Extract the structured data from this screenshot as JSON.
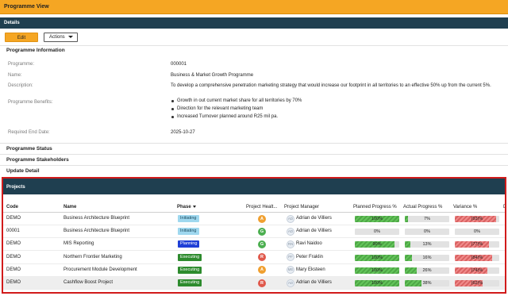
{
  "window": {
    "title": "Programme View"
  },
  "details": {
    "header": "Details",
    "edit_label": "Edit",
    "actions_label": "Actions"
  },
  "info": {
    "section_title": "Programme Information",
    "fields": [
      {
        "label": "Programme:",
        "value": "000001"
      },
      {
        "label": "Name:",
        "value": "Business & Market Growth Programme"
      },
      {
        "label": "Description:",
        "value": "To develop a comprehensive penetration marketing strategy that would increase our footprint in all territories to an effective 50% up from the current 5%."
      },
      {
        "label": "Programme Benefits:",
        "value": ""
      },
      {
        "label": "Required End Date:",
        "value": "2025-10-27"
      }
    ],
    "benefits": [
      "Growth in out current market share for all territories by 70%",
      "Direction for the relevant marketing team",
      "Increased Turnover planned around R25 mil pa."
    ]
  },
  "sections": [
    "Programme Status",
    "Programme Stakeholders",
    "Update Detail"
  ],
  "projects": {
    "header": "Projects",
    "columns": [
      "Code",
      "Name",
      "Phase",
      "Project Healt...",
      "Project Manager",
      "Planned Progress %",
      "Actual Progress %",
      "Variance %",
      "Da"
    ],
    "rows": [
      {
        "code": "DEMO",
        "name": "Business Architecture Blueprint",
        "phase": "Initiating",
        "health": "A",
        "pm_initials": "AD",
        "pm": "Adrian de Villiers",
        "planned": "100%",
        "planned_pct": 100,
        "actual": "7%",
        "actual_pct": 7,
        "variance": "(93)%",
        "variance_pct": 93
      },
      {
        "code": "00001",
        "name": "Business Architecture Blueprint",
        "phase": "Initiating",
        "health": "G",
        "pm_initials": "AD",
        "pm": "Adrian de Villiers",
        "planned": "0%",
        "planned_pct": 0,
        "actual": "0%",
        "actual_pct": 0,
        "variance": "0%",
        "variance_pct": 0
      },
      {
        "code": "DEMO",
        "name": "MIS Reporting",
        "phase": "Planning",
        "health": "G",
        "pm_initials": "RN",
        "pm": "Ravi Naidoo",
        "planned": "90%",
        "planned_pct": 90,
        "actual": "13%",
        "actual_pct": 13,
        "variance": "(77)%",
        "variance_pct": 77
      },
      {
        "code": "DEMO",
        "name": "Northern Frontier Marketing",
        "phase": "Executing",
        "health": "R",
        "pm_initials": "PF",
        "pm": "Peter Fraklin",
        "planned": "100%",
        "planned_pct": 100,
        "actual": "16%",
        "actual_pct": 16,
        "variance": "(84)%",
        "variance_pct": 84
      },
      {
        "code": "DEMO",
        "name": "Procurement Module Development",
        "phase": "Executing",
        "health": "A",
        "pm_initials": "ME",
        "pm": "Mary Eksteen",
        "planned": "100%",
        "planned_pct": 100,
        "actual": "26%",
        "actual_pct": 26,
        "variance": "(74)%",
        "variance_pct": 74
      },
      {
        "code": "DEMO",
        "name": "Cashflow Boost Project",
        "phase": "Executing",
        "health": "R",
        "pm_initials": "AD",
        "pm": "Adrian de Villiers",
        "planned": "100%",
        "planned_pct": 100,
        "actual": "38%",
        "actual_pct": 38,
        "variance": "(62)%",
        "variance_pct": 62
      }
    ]
  },
  "colors": {
    "accent": "#f5a623",
    "header_bg": "#1f3f50",
    "phase_initiating": "#9fd8ef",
    "phase_planning": "#1f3fd6",
    "phase_executing": "#2e8b2e",
    "health_A": "#f0a030",
    "health_G": "#4caf50",
    "health_R": "#e0584b"
  }
}
